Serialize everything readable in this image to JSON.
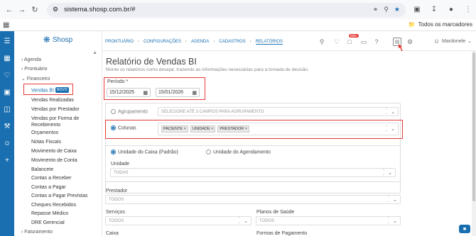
{
  "browser": {
    "url": "sistema.shosp.com.br/#",
    "bookmark_folder": "Todos os marcadores"
  },
  "brand": "Shosp",
  "sidebar": {
    "sections": [
      {
        "label": "Agenda"
      },
      {
        "label": "Prontuário"
      },
      {
        "label": "Financeiro"
      }
    ],
    "financeiro_items": [
      "Vendas BI",
      "Vendas Realizadas",
      "Vendas por Prestador",
      "Vendas por Forma de Recebimento",
      "Orçamentos",
      "Notas Fiscais",
      "Movimento de Caixa",
      "Movimento de Conta",
      "Balancete",
      "Contas a Receber",
      "Contas a Pagar",
      "Contas a Pagar Previstas",
      "Cheques Recebidos",
      "Repasse Médico",
      "DRE Gerencial"
    ],
    "new_badge": "NOVO",
    "faturamento": "Faturamento"
  },
  "breadcrumbs": [
    "PRONTUÁRIO",
    "CONFIGURAÇÕES",
    "AGENDA",
    "CADASTROS",
    "RELATÓRIOS"
  ],
  "topbar": {
    "notif_count": "999+",
    "user": "Mardonele"
  },
  "page": {
    "title": "Relatório de Vendas BI",
    "subtitle": "Monte os relatórios como desejar, trazendo as informações necessárias para a tomada de decisão.",
    "periodo_label": "Período *",
    "date_from": "15/12/2025",
    "date_to": "15/01/2026",
    "agrupamento_label": "Agrupamento",
    "agrupamento_placeholder": "SELECIONE ATÉ 3 CAMPOS PARA AGRUPAMENTO",
    "colunas_label": "Colunas",
    "colunas_tags": [
      "PACIENTE",
      "UNIDADE",
      "PRESTADOR"
    ],
    "unidade_caixa": "Unidade do Caixa (Padrão)",
    "unidade_agendamento": "Unidade do Agendamento",
    "unidade_label": "Unidade",
    "unidade_value": "TODAS",
    "prestador_label": "Prestador",
    "prestador_value": "TODOS",
    "servicos_label": "Serviços",
    "servicos_value": "TODOS",
    "planos_label": "Planos de Saúde",
    "planos_value": "TODOS",
    "caixa_label": "Caixa",
    "formas_label": "Formas de Pagamento"
  }
}
